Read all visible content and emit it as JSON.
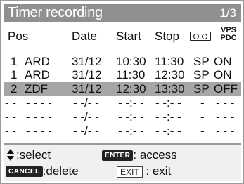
{
  "title": "Timer recording",
  "page": "1/3",
  "headers": {
    "pos": "Pos",
    "date": "Date",
    "start": "Start",
    "stop": "Stop",
    "tape_icon": "tape-icon",
    "vps_line1": "VPS",
    "vps_line2": "PDC"
  },
  "rows": [
    {
      "pos": "1",
      "channel": "ARD",
      "date": "31/12",
      "start": "10:30",
      "stop": "11:30",
      "speed": "SP",
      "vps": "ON",
      "selected": false
    },
    {
      "pos": "1",
      "channel": "ARD",
      "date": "31/12",
      "start": "11:30",
      "stop": "12:30",
      "speed": "SP",
      "vps": "ON",
      "selected": false
    },
    {
      "pos": "2",
      "channel": "ZDF",
      "date": "31/12",
      "start": "12:30",
      "stop": "13:30",
      "speed": "SP",
      "vps": "OFF",
      "selected": true
    },
    {
      "pos": "- -",
      "channel": "- - - -",
      "date": "- -/- -",
      "start": "- -:- -",
      "stop": "- -:- -",
      "speed": "-",
      "vps": "- - -",
      "selected": false
    },
    {
      "pos": "- -",
      "channel": "- - - -",
      "date": "- -/- -",
      "start": "- -:- -",
      "stop": "- -:- -",
      "speed": "-",
      "vps": "- - -",
      "selected": false
    },
    {
      "pos": "- -",
      "channel": "- - - -",
      "date": "- -/- -",
      "start": "- -:- -",
      "stop": "- -:- -",
      "speed": "-",
      "vps": "- - -",
      "selected": false
    }
  ],
  "footer": {
    "updown_icon": "up-down-arrows-icon",
    "select": ":select",
    "enter_key": "ENTER",
    "access": ": access",
    "cancel_key": "CANCEL",
    "delete": ":delete",
    "exit_key": "EXIT",
    "exit": ": exit"
  },
  "colors": {
    "title_bar": "#909090",
    "selected_row": "#a6a6a6"
  }
}
